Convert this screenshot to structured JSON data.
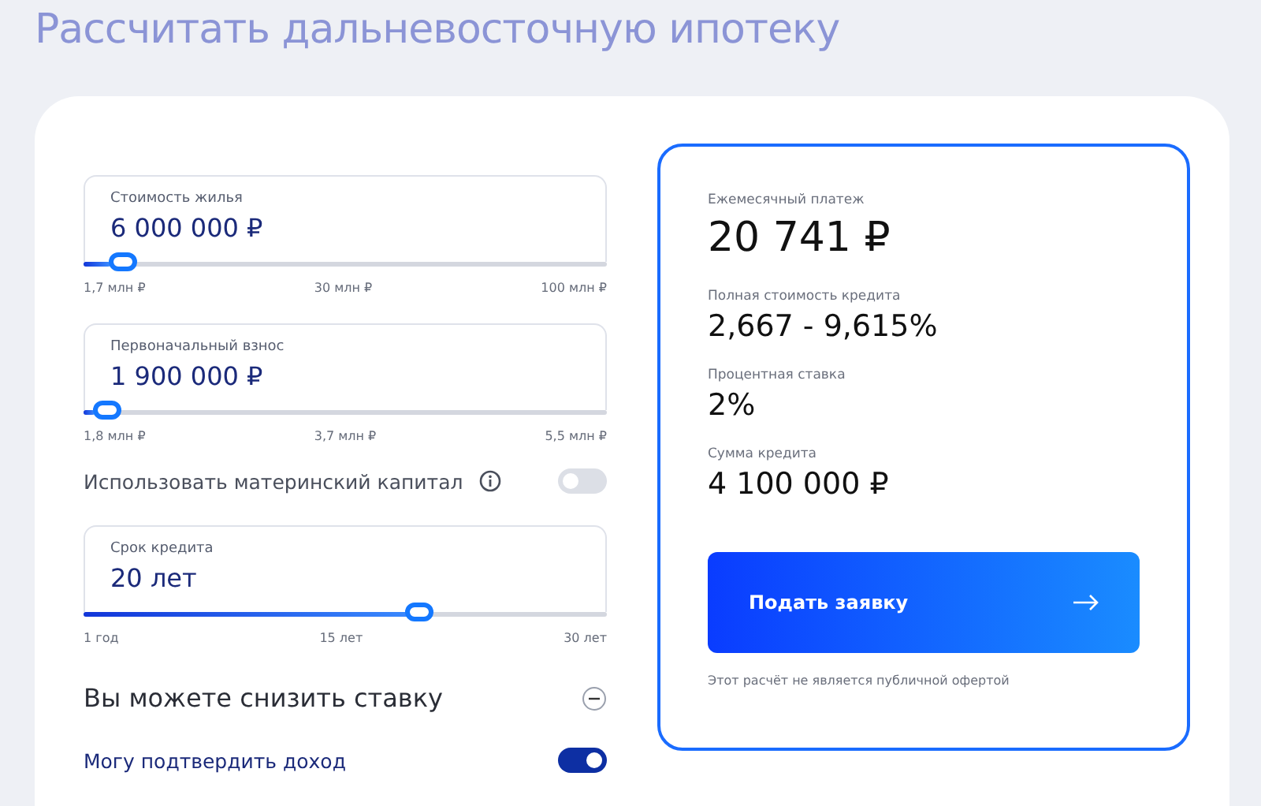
{
  "title": "Рассчитать дальневосточную ипотеку",
  "sliders": [
    {
      "label": "Стоимость жилья",
      "value": "6 000 000 ₽",
      "level": 0.05,
      "ticks": [
        "1,7 млн ₽",
        "30 млн ₽",
        "100 млн ₽"
      ]
    },
    {
      "label": "Первоначальный взнос",
      "value": "1 900 000 ₽",
      "level": 0.02,
      "ticks": [
        "1,8 млн ₽",
        "3,7 млн ₽",
        "5,5 млн ₽"
      ]
    },
    {
      "label": "Срок кредита",
      "value": "20 лет",
      "level": 0.65,
      "ticks": [
        "1 год",
        "15 лет",
        "30 лет"
      ]
    }
  ],
  "maternity_capital": {
    "label": "Использовать материнский капитал",
    "on": false
  },
  "discount_section": {
    "title": "Вы можете снизить ставку",
    "expanded": true
  },
  "confirm_income": {
    "label": "Могу подтвердить доход",
    "on": true
  },
  "results": [
    {
      "label": "Ежемесячный платеж",
      "value": "20 741 ₽",
      "kind": "main"
    },
    {
      "label": "Полная стоимость кредита",
      "value": "2,667 - 9,615%",
      "kind": "normal"
    },
    {
      "label": "Процентная ставка",
      "value": "2%",
      "kind": "normal"
    },
    {
      "label": "Сумма кредита",
      "value": "4 100 000 ₽",
      "kind": "normal"
    }
  ],
  "apply_button": "Подать заявку",
  "disclaimer": "Этот расчёт не является публичной офертой"
}
